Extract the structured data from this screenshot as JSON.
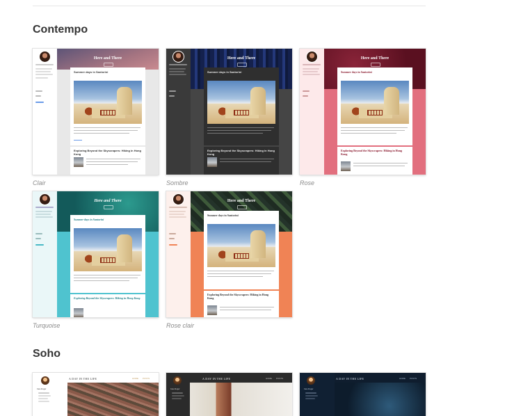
{
  "sections": {
    "contempo": {
      "title": "Contempo"
    },
    "soho": {
      "title": "Soho"
    }
  },
  "themes": {
    "clair": {
      "label": "Clair"
    },
    "sombre": {
      "label": "Sombre"
    },
    "rose": {
      "label": "Rose"
    },
    "turquoise": {
      "label": "Turquoise"
    },
    "rose_clair": {
      "label": "Rose clair"
    }
  },
  "preview": {
    "blog_title": "Here and There",
    "post1_title": "Summer days in Santorini",
    "post2_title": "Exploring Beyond the Skyscrapers: Hiking in Hong Kong",
    "soho_blog_title": "A DAY IN THE LIFE",
    "soho_author": "Jane Roger",
    "soho_nav1": "HOME",
    "soho_nav2": "POSTS"
  },
  "colors": {
    "clair_banner": "#8f6a78",
    "sombre_banner": "#1b2a55",
    "rose_banner": "#6e1729",
    "turquoise_banner": "#1f7a78",
    "rose_clair_banner": "#2b3a2f",
    "rose_bg": "#e26f7e",
    "turquoise_bg": "#4fc3cf",
    "rose_clair_bg": "#f08355"
  }
}
